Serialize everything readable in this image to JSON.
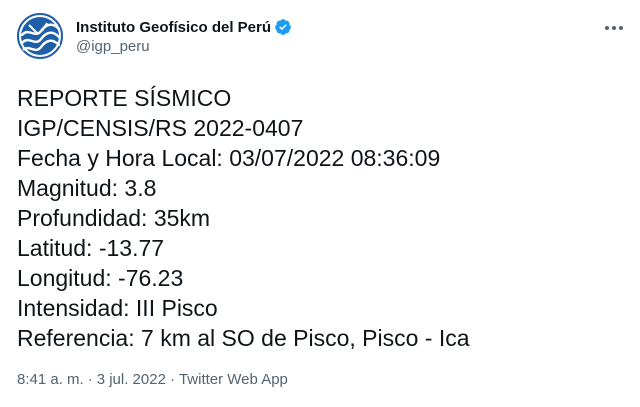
{
  "account": {
    "display_name": "Instituto Geofísico del Perú",
    "handle": "@igp_peru",
    "verified_icon": "verified-badge-icon",
    "avatar_icon": "igp-logo-icon",
    "brand_color": "#1f5fa8",
    "verified_color": "#1d9bf0"
  },
  "tweet": {
    "lines": [
      "REPORTE SÍSMICO",
      "IGP/CENSIS/RS 2022-0407",
      "Fecha y Hora Local: 03/07/2022 08:36:09",
      "Magnitud: 3.8",
      "Profundidad: 35km",
      "Latitud: -13.77",
      "Longitud: -76.23",
      "Intensidad: III Pisco",
      "Referencia: 7 km al SO de Pisco, Pisco - Ica"
    ]
  },
  "meta": {
    "time": "8:41 a. m.",
    "separator": "·",
    "date": "3 jul. 2022",
    "source": "Twitter Web App"
  },
  "menu": {
    "more_icon": "more-options-icon"
  }
}
